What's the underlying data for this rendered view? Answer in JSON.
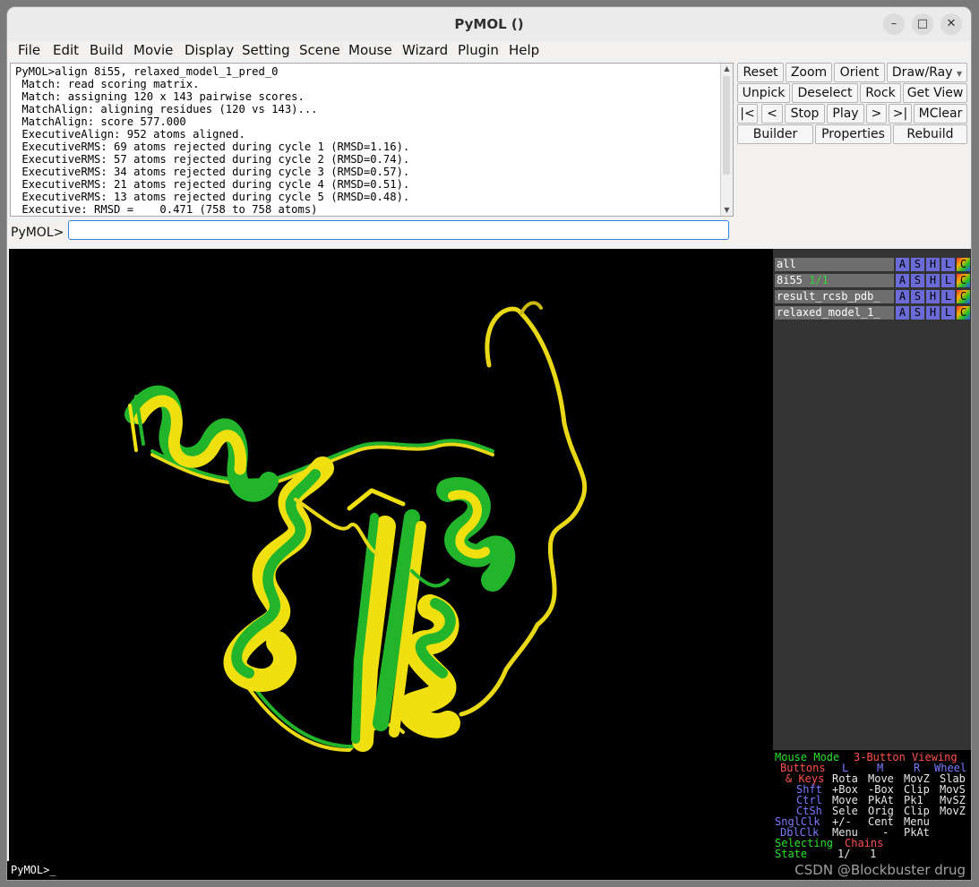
{
  "window": {
    "title": "PyMOL ()"
  },
  "menubar": [
    "File",
    "Edit",
    "Build",
    "Movie",
    "Display",
    "Setting",
    "Scene",
    "Mouse",
    "Wizard",
    "Plugin",
    "Help"
  ],
  "console": {
    "lines": [
      "PyMOL>align 8i55, relaxed_model_1_pred_0",
      " Match: read scoring matrix.",
      " Match: assigning 120 x 143 pairwise scores.",
      " MatchAlign: aligning residues (120 vs 143)...",
      " MatchAlign: score 577.000",
      " ExecutiveAlign: 952 atoms aligned.",
      " ExecutiveRMS: 69 atoms rejected during cycle 1 (RMSD=1.16).",
      " ExecutiveRMS: 57 atoms rejected during cycle 2 (RMSD=0.74).",
      " ExecutiveRMS: 34 atoms rejected during cycle 3 (RMSD=0.57).",
      " ExecutiveRMS: 21 atoms rejected during cycle 4 (RMSD=0.51).",
      " ExecutiveRMS: 13 atoms rejected during cycle 5 (RMSD=0.48).",
      " Executive: RMSD =    0.471 (758 to 758 atoms)"
    ]
  },
  "command": {
    "prompt": "PyMOL>",
    "value": ""
  },
  "buttons": {
    "reset": "Reset",
    "zoom": "Zoom",
    "orient": "Orient",
    "drawray": "Draw/Ray",
    "unpick": "Unpick",
    "deselect": "Deselect",
    "rock": "Rock",
    "getview": "Get View",
    "first": "|<",
    "prev": "<",
    "stop": "Stop",
    "play": "Play",
    "next": "> ",
    "last": ">|",
    "mclear": "MClear",
    "builder": "Builder",
    "properties": "Properties",
    "rebuild": "Rebuild"
  },
  "objects": [
    {
      "name": "all",
      "state": ""
    },
    {
      "name": "8i55",
      "state": "1/1"
    },
    {
      "name": "result_rcsb_pdb_",
      "state": ""
    },
    {
      "name": "relaxed_model_1_",
      "state": ""
    }
  ],
  "object_buttons": {
    "a": "A",
    "s": "S",
    "h": "H",
    "l": "L",
    "c": "C"
  },
  "mouse_panel": {
    "mode_label": "Mouse Mode",
    "mode_value": "3-Button Viewing",
    "buttons_label": "Buttons",
    "col_l": "L",
    "col_m": "M",
    "col_r": "R",
    "col_wheel": "Wheel",
    "keys_label": "& Keys",
    "rows": [
      {
        "key": "",
        "l": "Rota",
        "m": "Move",
        "r": "MovZ",
        "w": "Slab"
      },
      {
        "key": "Shft",
        "l": "+Box",
        "m": "-Box",
        "r": "Clip",
        "w": "MovS"
      },
      {
        "key": "Ctrl",
        "l": "Move",
        "m": "PkAt",
        "r": "Pk1",
        "w": "MvSZ"
      },
      {
        "key": "CtSh",
        "l": "Sele",
        "m": "Orig",
        "r": "Clip",
        "w": "MovZ"
      }
    ],
    "sngl_label": "SnglClk",
    "sngl_l": "+/-",
    "sngl_m": "Cent",
    "sngl_r": "Menu",
    "dbl_label": "DblClk",
    "dbl_l": "Menu",
    "dbl_m": "-",
    "dbl_r": "PkAt",
    "selecting_label": "Selecting",
    "selecting_value": "Chains",
    "state_label": "State",
    "state_value": "1/   1"
  },
  "bottom_prompt": "PyMOL>_",
  "watermark": "CSDN @Blockbuster drug",
  "colors": {
    "model_green": "#22b52b",
    "model_yellow": "#f0e010",
    "background": "#000000"
  }
}
